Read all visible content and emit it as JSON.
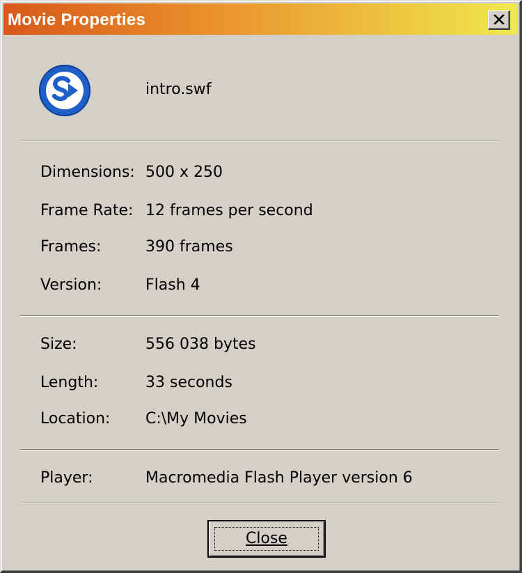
{
  "window": {
    "title": "Movie Properties"
  },
  "file": {
    "name": "intro.swf",
    "icon": "flash-player-icon"
  },
  "properties": {
    "dimensions": {
      "label": "Dimensions:",
      "value": "500 x 250"
    },
    "frame_rate": {
      "label": "Frame Rate:",
      "value": "12 frames per second"
    },
    "frames": {
      "label": "Frames:",
      "value": "390 frames"
    },
    "version": {
      "label": "Version:",
      "value": "Flash 4"
    },
    "size": {
      "label": "Size:",
      "value": "556 038 bytes"
    },
    "length": {
      "label": "Length:",
      "value": "33 seconds"
    },
    "location": {
      "label": "Location:",
      "value": "C:\\My Movies"
    },
    "player": {
      "label": "Player:",
      "value": "Macromedia Flash Player version 6"
    }
  },
  "buttons": {
    "close_label": "Close"
  },
  "colors": {
    "title_gradient_start": "#d7591a",
    "title_gradient_end": "#efe84d",
    "dialog_face": "#d4d0c8",
    "icon_blue": "#1e5fc8"
  }
}
